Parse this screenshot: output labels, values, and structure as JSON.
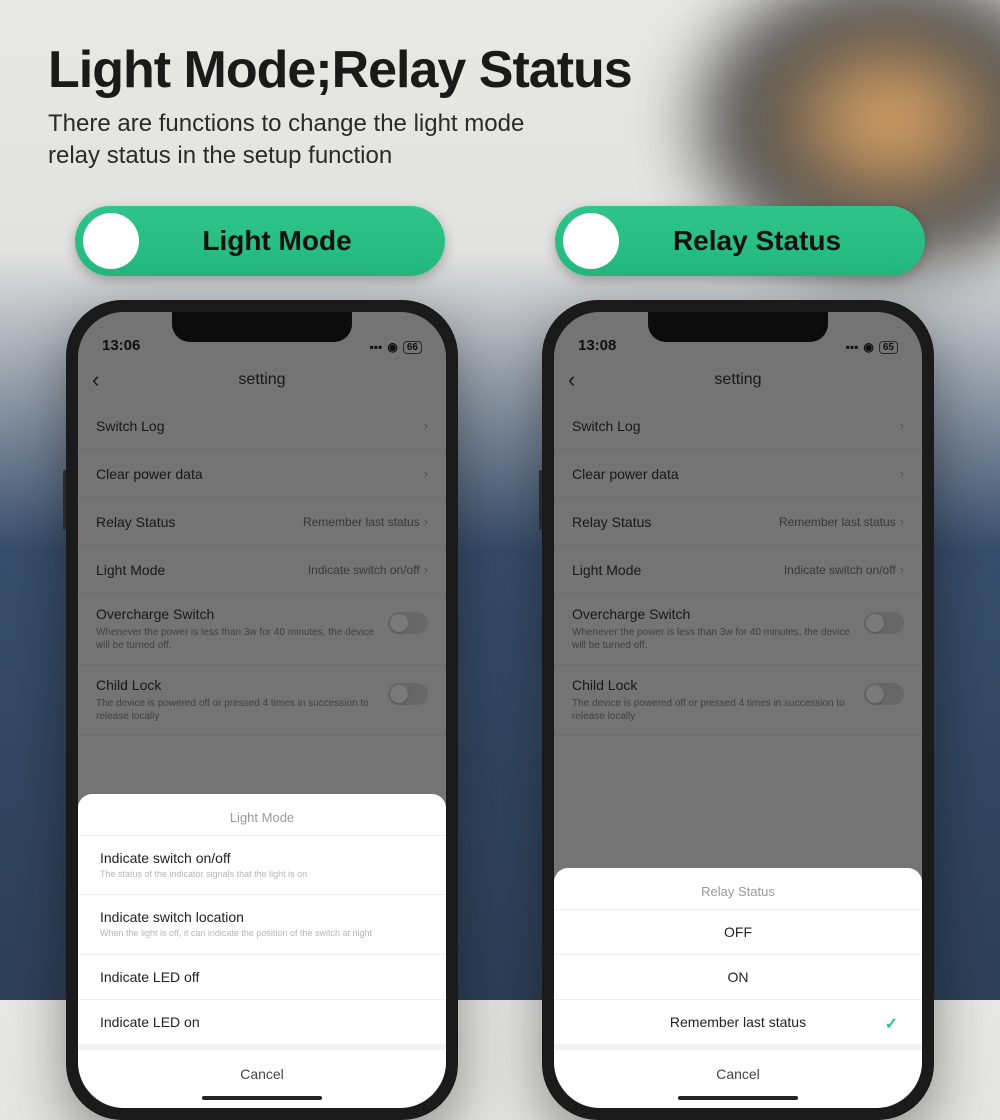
{
  "header": {
    "title": "Light Mode;Relay Status",
    "subtitle": "There are functions to change the light mode\nrelay status in the setup function"
  },
  "pills": {
    "left": "Light Mode",
    "right": "Relay Status"
  },
  "phone_left": {
    "status": {
      "time": "13:06",
      "battery": "66"
    },
    "nav_title": "setting",
    "settings": {
      "switch_log": "Switch Log",
      "clear_power": "Clear power data",
      "relay_status_label": "Relay Status",
      "relay_status_value": "Remember last status",
      "light_mode_label": "Light Mode",
      "light_mode_value": "Indicate switch on/off",
      "overcharge_label": "Overcharge Switch",
      "overcharge_desc": "Whenever the power is less than 3w for 40 minutes, the device will be turned off.",
      "child_lock_label": "Child Lock",
      "child_lock_desc": "The device is powered off or pressed 4 times in succession to release locally"
    },
    "sheet": {
      "title": "Light Mode",
      "opt1": {
        "label": "Indicate switch on/off",
        "desc": "The status of the indicator signals that the light is on"
      },
      "opt2": {
        "label": "Indicate switch location",
        "desc": "When the light is off, it can indicate the position of the switch at night"
      },
      "opt3": {
        "label": "Indicate LED off"
      },
      "opt4": {
        "label": "Indicate LED on"
      },
      "cancel": "Cancel"
    }
  },
  "phone_right": {
    "status": {
      "time": "13:08",
      "battery": "65"
    },
    "nav_title": "setting",
    "settings": {
      "switch_log": "Switch Log",
      "clear_power": "Clear power data",
      "relay_status_label": "Relay Status",
      "relay_status_value": "Remember last status",
      "light_mode_label": "Light Mode",
      "light_mode_value": "Indicate switch on/off",
      "overcharge_label": "Overcharge Switch",
      "overcharge_desc": "Whenever the power is less than 3w for 40 minutes, the device will be turned off.",
      "child_lock_label": "Child Lock",
      "child_lock_desc": "The device is powered off or pressed 4 times in succession to release locally"
    },
    "sheet": {
      "title": "Relay Status",
      "opt1": "OFF",
      "opt2": "ON",
      "opt3": "Remember last status",
      "cancel": "Cancel"
    }
  }
}
